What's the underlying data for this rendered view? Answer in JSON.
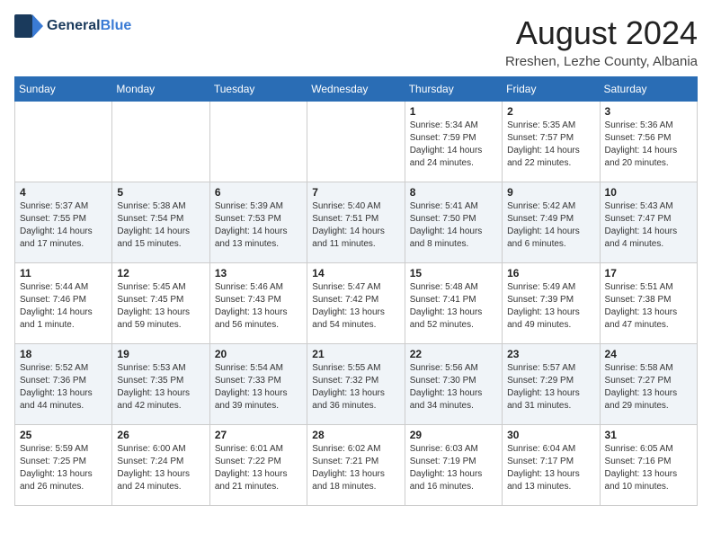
{
  "logo": {
    "general": "General",
    "blue": "Blue"
  },
  "title": {
    "month_year": "August 2024",
    "location": "Rreshen, Lezhe County, Albania"
  },
  "calendar": {
    "headers": [
      "Sunday",
      "Monday",
      "Tuesday",
      "Wednesday",
      "Thursday",
      "Friday",
      "Saturday"
    ],
    "weeks": [
      [
        {
          "day": "",
          "info": ""
        },
        {
          "day": "",
          "info": ""
        },
        {
          "day": "",
          "info": ""
        },
        {
          "day": "",
          "info": ""
        },
        {
          "day": "1",
          "info": "Sunrise: 5:34 AM\nSunset: 7:59 PM\nDaylight: 14 hours\nand 24 minutes."
        },
        {
          "day": "2",
          "info": "Sunrise: 5:35 AM\nSunset: 7:57 PM\nDaylight: 14 hours\nand 22 minutes."
        },
        {
          "day": "3",
          "info": "Sunrise: 5:36 AM\nSunset: 7:56 PM\nDaylight: 14 hours\nand 20 minutes."
        }
      ],
      [
        {
          "day": "4",
          "info": "Sunrise: 5:37 AM\nSunset: 7:55 PM\nDaylight: 14 hours\nand 17 minutes."
        },
        {
          "day": "5",
          "info": "Sunrise: 5:38 AM\nSunset: 7:54 PM\nDaylight: 14 hours\nand 15 minutes."
        },
        {
          "day": "6",
          "info": "Sunrise: 5:39 AM\nSunset: 7:53 PM\nDaylight: 14 hours\nand 13 minutes."
        },
        {
          "day": "7",
          "info": "Sunrise: 5:40 AM\nSunset: 7:51 PM\nDaylight: 14 hours\nand 11 minutes."
        },
        {
          "day": "8",
          "info": "Sunrise: 5:41 AM\nSunset: 7:50 PM\nDaylight: 14 hours\nand 8 minutes."
        },
        {
          "day": "9",
          "info": "Sunrise: 5:42 AM\nSunset: 7:49 PM\nDaylight: 14 hours\nand 6 minutes."
        },
        {
          "day": "10",
          "info": "Sunrise: 5:43 AM\nSunset: 7:47 PM\nDaylight: 14 hours\nand 4 minutes."
        }
      ],
      [
        {
          "day": "11",
          "info": "Sunrise: 5:44 AM\nSunset: 7:46 PM\nDaylight: 14 hours\nand 1 minute."
        },
        {
          "day": "12",
          "info": "Sunrise: 5:45 AM\nSunset: 7:45 PM\nDaylight: 13 hours\nand 59 minutes."
        },
        {
          "day": "13",
          "info": "Sunrise: 5:46 AM\nSunset: 7:43 PM\nDaylight: 13 hours\nand 56 minutes."
        },
        {
          "day": "14",
          "info": "Sunrise: 5:47 AM\nSunset: 7:42 PM\nDaylight: 13 hours\nand 54 minutes."
        },
        {
          "day": "15",
          "info": "Sunrise: 5:48 AM\nSunset: 7:41 PM\nDaylight: 13 hours\nand 52 minutes."
        },
        {
          "day": "16",
          "info": "Sunrise: 5:49 AM\nSunset: 7:39 PM\nDaylight: 13 hours\nand 49 minutes."
        },
        {
          "day": "17",
          "info": "Sunrise: 5:51 AM\nSunset: 7:38 PM\nDaylight: 13 hours\nand 47 minutes."
        }
      ],
      [
        {
          "day": "18",
          "info": "Sunrise: 5:52 AM\nSunset: 7:36 PM\nDaylight: 13 hours\nand 44 minutes."
        },
        {
          "day": "19",
          "info": "Sunrise: 5:53 AM\nSunset: 7:35 PM\nDaylight: 13 hours\nand 42 minutes."
        },
        {
          "day": "20",
          "info": "Sunrise: 5:54 AM\nSunset: 7:33 PM\nDaylight: 13 hours\nand 39 minutes."
        },
        {
          "day": "21",
          "info": "Sunrise: 5:55 AM\nSunset: 7:32 PM\nDaylight: 13 hours\nand 36 minutes."
        },
        {
          "day": "22",
          "info": "Sunrise: 5:56 AM\nSunset: 7:30 PM\nDaylight: 13 hours\nand 34 minutes."
        },
        {
          "day": "23",
          "info": "Sunrise: 5:57 AM\nSunset: 7:29 PM\nDaylight: 13 hours\nand 31 minutes."
        },
        {
          "day": "24",
          "info": "Sunrise: 5:58 AM\nSunset: 7:27 PM\nDaylight: 13 hours\nand 29 minutes."
        }
      ],
      [
        {
          "day": "25",
          "info": "Sunrise: 5:59 AM\nSunset: 7:25 PM\nDaylight: 13 hours\nand 26 minutes."
        },
        {
          "day": "26",
          "info": "Sunrise: 6:00 AM\nSunset: 7:24 PM\nDaylight: 13 hours\nand 24 minutes."
        },
        {
          "day": "27",
          "info": "Sunrise: 6:01 AM\nSunset: 7:22 PM\nDaylight: 13 hours\nand 21 minutes."
        },
        {
          "day": "28",
          "info": "Sunrise: 6:02 AM\nSunset: 7:21 PM\nDaylight: 13 hours\nand 18 minutes."
        },
        {
          "day": "29",
          "info": "Sunrise: 6:03 AM\nSunset: 7:19 PM\nDaylight: 13 hours\nand 16 minutes."
        },
        {
          "day": "30",
          "info": "Sunrise: 6:04 AM\nSunset: 7:17 PM\nDaylight: 13 hours\nand 13 minutes."
        },
        {
          "day": "31",
          "info": "Sunrise: 6:05 AM\nSunset: 7:16 PM\nDaylight: 13 hours\nand 10 minutes."
        }
      ]
    ]
  }
}
